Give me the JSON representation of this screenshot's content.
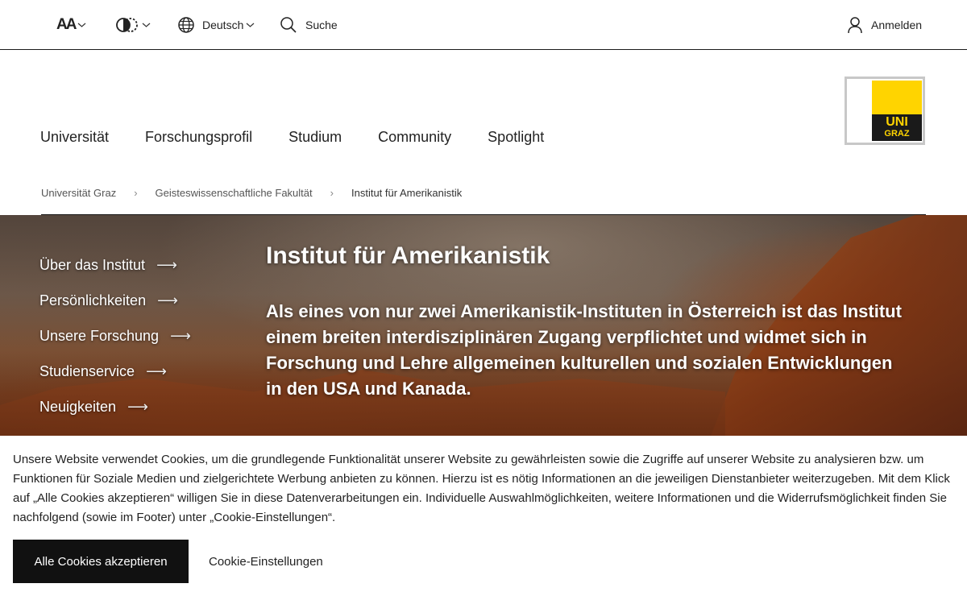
{
  "topbar": {
    "font_size_label": "AA",
    "language": "Deutsch",
    "search": "Suche",
    "login": "Anmelden"
  },
  "mainnav": [
    "Universität",
    "Forschungsprofil",
    "Studium",
    "Community",
    "Spotlight"
  ],
  "logo": {
    "line1": "UNI",
    "line2": "GRAZ"
  },
  "breadcrumb": [
    "Universität Graz",
    "Geisteswissenschaftliche Fakultät",
    "Institut für Amerikanistik"
  ],
  "breadcrumb_sep": "›",
  "sidenav": [
    "Über das Institut",
    "Persönlichkeiten",
    "Unsere Forschung",
    "Studienservice",
    "Neuigkeiten"
  ],
  "sidenav_arrow": "⟶",
  "hero": {
    "title": "Institut für Amerikanistik",
    "text": "Als eines von nur zwei Amerikanistik-Instituten in Österreich ist das Institut einem breiten interdisziplinären Zugang verpflichtet und widmet sich in Forschung und Lehre allgemeinen kulturellen und sozialen Entwicklungen in den USA und Kanada."
  },
  "cookie": {
    "text": "Unsere Website verwendet Cookies, um die grundlegende Funktionalität unserer Website zu gewährleisten sowie die Zugriffe auf unserer Website zu analysieren bzw. um Funktionen für Soziale Medien und zielgerichtete Werbung anbieten zu können. Hierzu ist es nötig Informationen an die jeweiligen Dienstanbieter weiterzugeben. Mit dem Klick auf „Alle Cookies akzeptieren“ willigen Sie in diese Datenverarbeitungen ein. Individuelle Auswahlmöglichkeiten, weitere Informationen und die Widerrufsmöglichkeit finden Sie nachfolgend (sowie im Footer) unter „Cookie-Einstellungen“.",
    "accept": "Alle Cookies akzeptieren",
    "settings": "Cookie-Einstellungen"
  },
  "colors": {
    "brand_yellow": "#ffd400",
    "dark": "#1a1a1a"
  }
}
